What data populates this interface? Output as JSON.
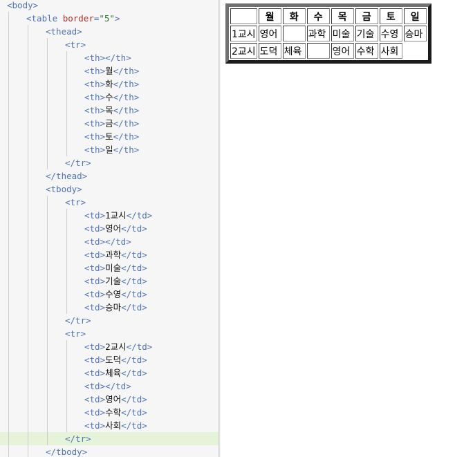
{
  "editor": {
    "lines": [
      {
        "indent": 0,
        "tokens": [
          {
            "k": "t",
            "v": "<body>"
          }
        ]
      },
      {
        "indent": 1,
        "tokens": [
          {
            "k": "t",
            "v": "<table "
          },
          {
            "k": "at",
            "v": "border"
          },
          {
            "k": "t",
            "v": "="
          },
          {
            "k": "av",
            "v": "\"5\""
          },
          {
            "k": "t",
            "v": ">"
          }
        ]
      },
      {
        "indent": 2,
        "tokens": [
          {
            "k": "t",
            "v": "<thead>"
          }
        ]
      },
      {
        "indent": 3,
        "tokens": [
          {
            "k": "t",
            "v": "<tr>"
          }
        ]
      },
      {
        "indent": 4,
        "tokens": [
          {
            "k": "t",
            "v": "<th></th>"
          }
        ]
      },
      {
        "indent": 4,
        "tokens": [
          {
            "k": "t",
            "v": "<th>"
          },
          {
            "k": "tx",
            "v": "월"
          },
          {
            "k": "t",
            "v": "</th>"
          }
        ]
      },
      {
        "indent": 4,
        "tokens": [
          {
            "k": "t",
            "v": "<th>"
          },
          {
            "k": "tx",
            "v": "화"
          },
          {
            "k": "t",
            "v": "</th>"
          }
        ]
      },
      {
        "indent": 4,
        "tokens": [
          {
            "k": "t",
            "v": "<th>"
          },
          {
            "k": "tx",
            "v": "수"
          },
          {
            "k": "t",
            "v": "</th>"
          }
        ]
      },
      {
        "indent": 4,
        "tokens": [
          {
            "k": "t",
            "v": "<th>"
          },
          {
            "k": "tx",
            "v": "목"
          },
          {
            "k": "t",
            "v": "</th>"
          }
        ]
      },
      {
        "indent": 4,
        "tokens": [
          {
            "k": "t",
            "v": "<th>"
          },
          {
            "k": "tx",
            "v": "금"
          },
          {
            "k": "t",
            "v": "</th>"
          }
        ]
      },
      {
        "indent": 4,
        "tokens": [
          {
            "k": "t",
            "v": "<th>"
          },
          {
            "k": "tx",
            "v": "토"
          },
          {
            "k": "t",
            "v": "</th>"
          }
        ]
      },
      {
        "indent": 4,
        "tokens": [
          {
            "k": "t",
            "v": "<th>"
          },
          {
            "k": "tx",
            "v": "일"
          },
          {
            "k": "t",
            "v": "</th>"
          }
        ]
      },
      {
        "indent": 3,
        "tokens": [
          {
            "k": "t",
            "v": "</tr>"
          }
        ]
      },
      {
        "indent": 2,
        "tokens": [
          {
            "k": "t",
            "v": "</thead>"
          }
        ]
      },
      {
        "indent": 2,
        "tokens": [
          {
            "k": "t",
            "v": "<tbody>"
          }
        ]
      },
      {
        "indent": 3,
        "tokens": [
          {
            "k": "t",
            "v": "<tr>"
          }
        ]
      },
      {
        "indent": 4,
        "tokens": [
          {
            "k": "t",
            "v": "<td>"
          },
          {
            "k": "tx",
            "v": "1교시"
          },
          {
            "k": "t",
            "v": "</td>"
          }
        ]
      },
      {
        "indent": 4,
        "tokens": [
          {
            "k": "t",
            "v": "<td>"
          },
          {
            "k": "tx",
            "v": "영어"
          },
          {
            "k": "t",
            "v": "</td>"
          }
        ]
      },
      {
        "indent": 4,
        "tokens": [
          {
            "k": "t",
            "v": "<td></td>"
          }
        ]
      },
      {
        "indent": 4,
        "tokens": [
          {
            "k": "t",
            "v": "<td>"
          },
          {
            "k": "tx",
            "v": "과학"
          },
          {
            "k": "t",
            "v": "</td>"
          }
        ]
      },
      {
        "indent": 4,
        "tokens": [
          {
            "k": "t",
            "v": "<td>"
          },
          {
            "k": "tx",
            "v": "미술"
          },
          {
            "k": "t",
            "v": "</td>"
          }
        ]
      },
      {
        "indent": 4,
        "tokens": [
          {
            "k": "t",
            "v": "<td>"
          },
          {
            "k": "tx",
            "v": "기술"
          },
          {
            "k": "t",
            "v": "</td>"
          }
        ]
      },
      {
        "indent": 4,
        "tokens": [
          {
            "k": "t",
            "v": "<td>"
          },
          {
            "k": "tx",
            "v": "수영"
          },
          {
            "k": "t",
            "v": "</td>"
          }
        ]
      },
      {
        "indent": 4,
        "tokens": [
          {
            "k": "t",
            "v": "<td>"
          },
          {
            "k": "tx",
            "v": "승마"
          },
          {
            "k": "t",
            "v": "</td>"
          }
        ]
      },
      {
        "indent": 3,
        "tokens": [
          {
            "k": "t",
            "v": "</tr>"
          }
        ]
      },
      {
        "indent": 3,
        "tokens": [
          {
            "k": "t",
            "v": "<tr>"
          }
        ]
      },
      {
        "indent": 4,
        "tokens": [
          {
            "k": "t",
            "v": "<td>"
          },
          {
            "k": "tx",
            "v": "2교시"
          },
          {
            "k": "t",
            "v": "</td>"
          }
        ]
      },
      {
        "indent": 4,
        "tokens": [
          {
            "k": "t",
            "v": "<td>"
          },
          {
            "k": "tx",
            "v": "도덕"
          },
          {
            "k": "t",
            "v": "</td>"
          }
        ]
      },
      {
        "indent": 4,
        "tokens": [
          {
            "k": "t",
            "v": "<td>"
          },
          {
            "k": "tx",
            "v": "체육"
          },
          {
            "k": "t",
            "v": "</td>"
          }
        ]
      },
      {
        "indent": 4,
        "tokens": [
          {
            "k": "t",
            "v": "<td></td>"
          }
        ]
      },
      {
        "indent": 4,
        "tokens": [
          {
            "k": "t",
            "v": "<td>"
          },
          {
            "k": "tx",
            "v": "영어"
          },
          {
            "k": "t",
            "v": "</td>"
          }
        ]
      },
      {
        "indent": 4,
        "tokens": [
          {
            "k": "t",
            "v": "<td>"
          },
          {
            "k": "tx",
            "v": "수학"
          },
          {
            "k": "t",
            "v": "</td>"
          }
        ]
      },
      {
        "indent": 4,
        "tokens": [
          {
            "k": "t",
            "v": "<td>"
          },
          {
            "k": "tx",
            "v": "사회"
          },
          {
            "k": "t",
            "v": "</td>"
          }
        ]
      },
      {
        "indent": 3,
        "tokens": [
          {
            "k": "t",
            "v": "</tr>"
          }
        ],
        "highlight": true
      },
      {
        "indent": 2,
        "tokens": [
          {
            "k": "t",
            "v": "</tbody>"
          }
        ]
      }
    ]
  },
  "preview": {
    "headers": [
      "",
      "월",
      "화",
      "수",
      "목",
      "금",
      "토",
      "일"
    ],
    "rows": [
      [
        "1교시",
        "영어",
        "",
        "과학",
        "미술",
        "기술",
        "수영",
        "승마"
      ],
      [
        "2교시",
        "도덕",
        "체육",
        "",
        "영어",
        "수학",
        "사회"
      ]
    ]
  },
  "colors": {
    "editor_bg": "#f6f6f6",
    "tag": "#4f73b8",
    "attr_name": "#b0312f",
    "attr_value": "#2e7a2e",
    "current_line": "#e5f4d9"
  }
}
